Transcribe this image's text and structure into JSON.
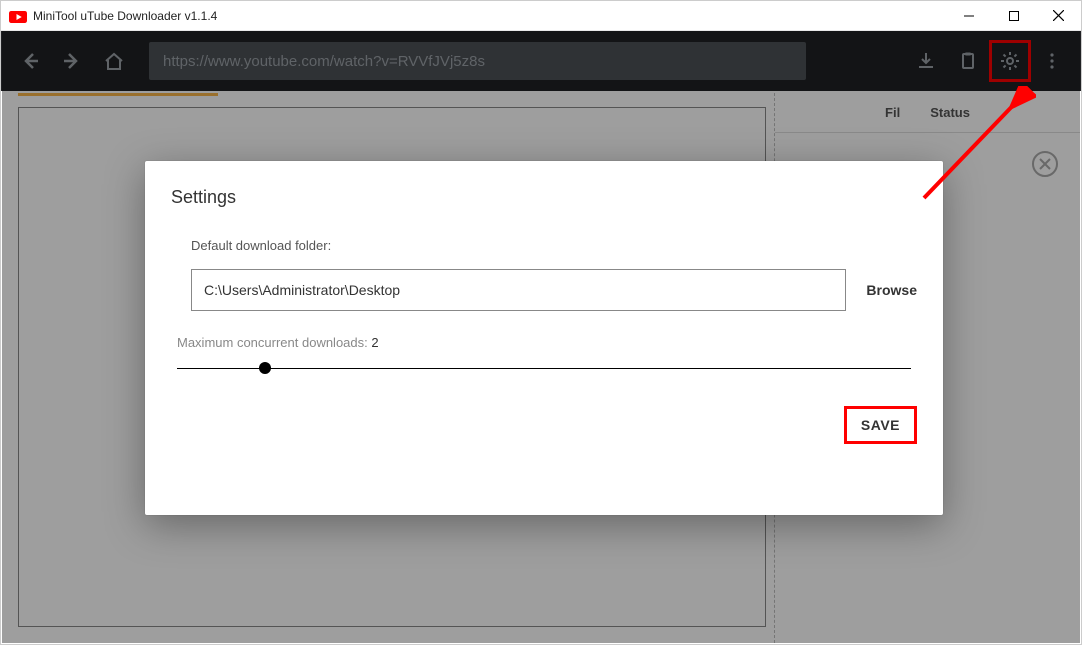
{
  "titlebar": {
    "title": "MiniTool uTube Downloader v1.1.4"
  },
  "navbar": {
    "url": "https://www.youtube.com/watch?v=RVVfJVj5z8s"
  },
  "side": {
    "col1": "Fil",
    "col2": "Status"
  },
  "modal": {
    "title": "Settings",
    "folder_label": "Default download folder:",
    "folder_value": "C:\\Users\\Administrator\\Desktop",
    "browse": "Browse",
    "mcd_label": "Maximum concurrent downloads: ",
    "mcd_value": "2",
    "save": "SAVE"
  },
  "slider": {
    "percent": 12
  },
  "colors": {
    "accent_red": "#ff0000",
    "orange": "#f8b54a",
    "navbar": "#202124"
  }
}
